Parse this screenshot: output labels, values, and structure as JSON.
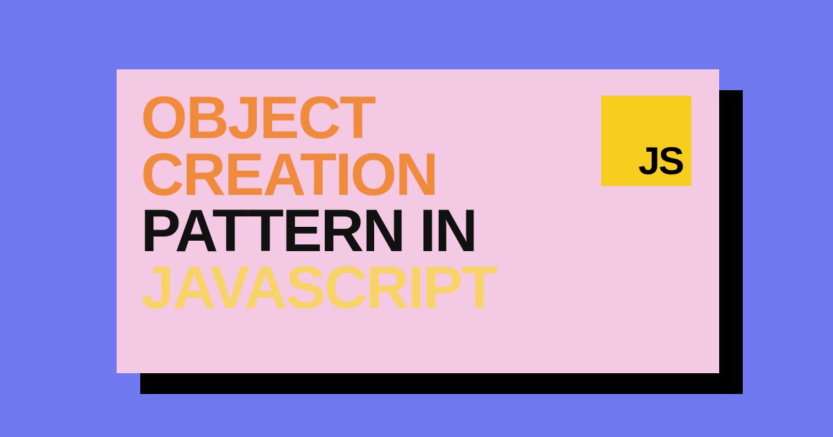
{
  "title": {
    "line1": "OBJECT",
    "line2": "CREATION",
    "line3": "PATTERN IN",
    "line4": "JAVASCRIPT"
  },
  "badge": {
    "label": "JS"
  },
  "colors": {
    "background": "#7078f0",
    "card": "#f4c9e3",
    "shadow": "#000000",
    "orange": "#f08a3c",
    "black": "#111111",
    "yellow": "#f8d468",
    "badge_bg": "#f7cd1e"
  }
}
